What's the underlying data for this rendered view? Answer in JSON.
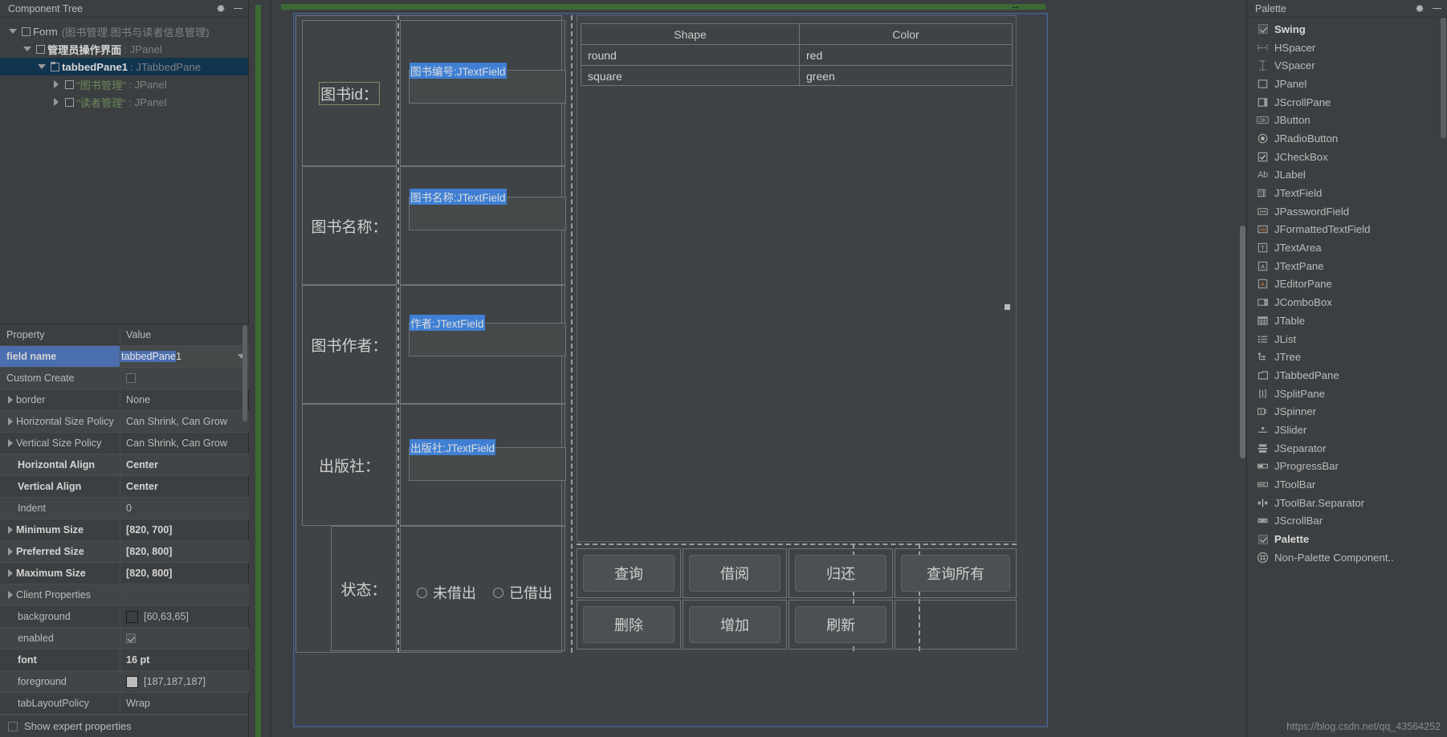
{
  "left_panel": {
    "title": "Component Tree",
    "icons": {
      "settings": "gear-icon",
      "minimize": "minimize-icon"
    },
    "tree": [
      {
        "indent": 0,
        "twisty": "down",
        "icon": "panel-box-icon",
        "name": "Form",
        "bold": false,
        "paren": "(图书管理.图书与读者信息管理)",
        "type": "",
        "selected": false
      },
      {
        "indent": 1,
        "twisty": "down",
        "icon": "panel-box-icon",
        "name": "管理员操作界面",
        "bold": true,
        "paren": "",
        "type": ": JPanel",
        "selected": false
      },
      {
        "indent": 2,
        "twisty": "down",
        "icon": "tabbed-pane-icon",
        "name": "tabbedPane1",
        "bold": true,
        "paren": "",
        "type": ": JTabbedPane",
        "selected": true
      },
      {
        "indent": 3,
        "twisty": "right",
        "icon": "panel-box-icon",
        "name": "\"图书管理\"",
        "bold": false,
        "green": true,
        "paren": "",
        "type": ": JPanel",
        "selected": false
      },
      {
        "indent": 3,
        "twisty": "right",
        "icon": "panel-box-icon",
        "name": "\"读者管理\"",
        "bold": false,
        "green": true,
        "paren": "",
        "type": ": JPanel",
        "selected": false
      }
    ],
    "property_table": {
      "headers": {
        "property": "Property",
        "value": "Value"
      },
      "rows": [
        {
          "key": "field name",
          "value": "tabbedPane1",
          "editing": true,
          "selected_text": "tabbedPane",
          "rest_text": "1",
          "kind": "edit",
          "bold": true
        },
        {
          "key": "Custom Create",
          "value": "",
          "kind": "checkbox",
          "checked": false
        },
        {
          "key": "border",
          "value": "None",
          "kind": "text",
          "expandable": true
        },
        {
          "key": "Horizontal Size Policy",
          "value": "Can Shrink, Can Grow",
          "kind": "text",
          "expandable": true
        },
        {
          "key": "Vertical Size Policy",
          "value": "Can Shrink, Can Grow",
          "kind": "text",
          "expandable": true
        },
        {
          "key": "Horizontal Align",
          "value": "Center",
          "kind": "text",
          "bold": true
        },
        {
          "key": "Vertical Align",
          "value": "Center",
          "kind": "text",
          "bold": true
        },
        {
          "key": "Indent",
          "value": "0",
          "kind": "text"
        },
        {
          "key": "Minimum Size",
          "value": "[820, 700]",
          "kind": "text",
          "expandable": true,
          "bold": true
        },
        {
          "key": "Preferred Size",
          "value": "[820, 800]",
          "kind": "text",
          "expandable": true,
          "bold": true
        },
        {
          "key": "Maximum Size",
          "value": "[820, 800]",
          "kind": "text",
          "expandable": true,
          "bold": true
        },
        {
          "key": "Client Properties",
          "value": "",
          "kind": "text",
          "expandable": true
        },
        {
          "key": "background",
          "value": "[60,63,65]",
          "kind": "color",
          "swatch": "#3c3f41"
        },
        {
          "key": "enabled",
          "value": "",
          "kind": "checkbox",
          "checked": true
        },
        {
          "key": "font",
          "value": "16 pt",
          "kind": "text",
          "bold": true
        },
        {
          "key": "foreground",
          "value": "[187,187,187]",
          "kind": "color",
          "swatch": "#bbbbbb"
        },
        {
          "key": "tabLayoutPolicy",
          "value": "Wrap",
          "kind": "text"
        }
      ],
      "expert_toggle": {
        "label": "Show expert properties",
        "checked": false
      }
    }
  },
  "canvas": {
    "labels": {
      "book_id": "图书id：",
      "book_name": "图书名称：",
      "book_author": "图书作者：",
      "publisher": "出版社：",
      "status": "状态："
    },
    "textfields": [
      {
        "name": "book-no-field",
        "text": "图书编号:JTextField"
      },
      {
        "name": "book-name-field",
        "text": "图书名称:JTextField"
      },
      {
        "name": "author-field",
        "text": "作者:JTextField"
      },
      {
        "name": "publisher-field",
        "text": "出版社:JTextField"
      }
    ],
    "radios": [
      {
        "label": "未借出",
        "selected": false
      },
      {
        "label": "已借出",
        "selected": false
      }
    ],
    "table": {
      "columns": [
        "Shape",
        "Color"
      ],
      "rows": [
        [
          "round",
          "red"
        ],
        [
          "square",
          "green"
        ]
      ]
    },
    "buttons_row1": [
      "查询",
      "借阅",
      "归还",
      "查询所有"
    ],
    "buttons_row2": [
      "删除",
      "增加",
      "刷新"
    ]
  },
  "right_panel": {
    "title": "Palette",
    "icons": {
      "settings": "gear-icon",
      "minimize": "minimize-icon"
    },
    "items": [
      {
        "label": "Swing",
        "icon": "checkbox-checked-icon",
        "group": true
      },
      {
        "label": "HSpacer",
        "icon": "hspacer-icon"
      },
      {
        "label": "VSpacer",
        "icon": "vspacer-icon"
      },
      {
        "label": "JPanel",
        "icon": "panel-icon"
      },
      {
        "label": "JScrollPane",
        "icon": "scrollpane-icon"
      },
      {
        "label": "JButton",
        "icon": "button-ok-icon"
      },
      {
        "label": "JRadioButton",
        "icon": "radiobutton-icon"
      },
      {
        "label": "JCheckBox",
        "icon": "checkbox-icon"
      },
      {
        "label": "JLabel",
        "icon": "label-ab-icon"
      },
      {
        "label": "JTextField",
        "icon": "textfield-icon"
      },
      {
        "label": "JPasswordField",
        "icon": "passwordfield-icon"
      },
      {
        "label": "JFormattedTextField",
        "icon": "formattedtextfield-icon"
      },
      {
        "label": "JTextArea",
        "icon": "textarea-icon"
      },
      {
        "label": "JTextPane",
        "icon": "textpane-icon"
      },
      {
        "label": "JEditorPane",
        "icon": "editorpane-icon"
      },
      {
        "label": "JComboBox",
        "icon": "combobox-icon"
      },
      {
        "label": "JTable",
        "icon": "table-icon"
      },
      {
        "label": "JList",
        "icon": "list-icon"
      },
      {
        "label": "JTree",
        "icon": "tree-icon"
      },
      {
        "label": "JTabbedPane",
        "icon": "tabbedpane-icon"
      },
      {
        "label": "JSplitPane",
        "icon": "splitpane-icon"
      },
      {
        "label": "JSpinner",
        "icon": "spinner-icon"
      },
      {
        "label": "JSlider",
        "icon": "slider-icon"
      },
      {
        "label": "JSeparator",
        "icon": "separator-icon"
      },
      {
        "label": "JProgressBar",
        "icon": "progressbar-icon"
      },
      {
        "label": "JToolBar",
        "icon": "toolbar-icon"
      },
      {
        "label": "JToolBar.Separator",
        "icon": "toolbar-separator-icon"
      },
      {
        "label": "JScrollBar",
        "icon": "scrollbar-icon"
      },
      {
        "label": "Palette",
        "icon": "checkbox-checked-icon",
        "group": true
      },
      {
        "label": "Non-Palette Component..",
        "icon": "non-palette-icon"
      }
    ]
  },
  "watermark": "https://blog.csdn.net/qq_43564252"
}
